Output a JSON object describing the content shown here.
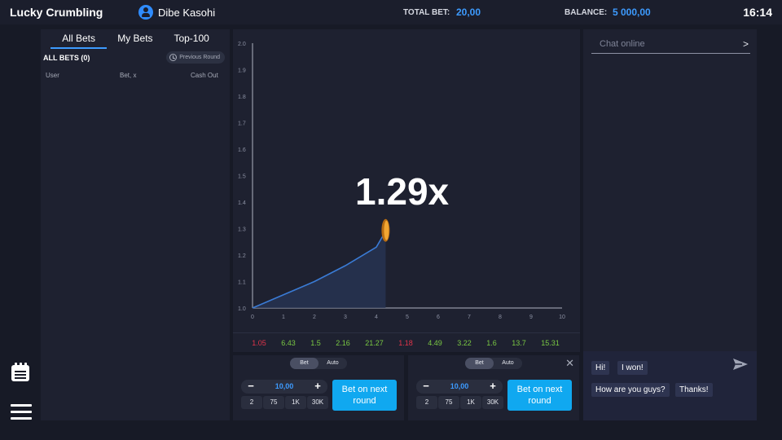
{
  "header": {
    "brand": "Lucky Crumbling",
    "username": "Dibe Kasohi",
    "total_bet_label": "TOTAL BET:",
    "total_bet_value": "20,00",
    "balance_label": "BALANCE:",
    "balance_value": "5 000,00",
    "time": "16:14"
  },
  "bets_panel": {
    "tabs": [
      "All Bets",
      "My Bets",
      "Top-100"
    ],
    "active_tab": "All Bets",
    "all_bets_label": "ALL BETS (0)",
    "previous_round_label": "Previous Round",
    "columns": [
      "User",
      "Bet, x",
      "Cash Out"
    ]
  },
  "game": {
    "multiplier": "1.29x",
    "history": [
      {
        "value": "1.05",
        "color": "#e0344a"
      },
      {
        "value": "6.43",
        "color": "#7ac943"
      },
      {
        "value": "1.5",
        "color": "#7ac943"
      },
      {
        "value": "2.16",
        "color": "#7ac943"
      },
      {
        "value": "21.27",
        "color": "#7ac943"
      },
      {
        "value": "1.18",
        "color": "#e0344a"
      },
      {
        "value": "4.49",
        "color": "#7ac943"
      },
      {
        "value": "3.22",
        "color": "#7ac943"
      },
      {
        "value": "1.6",
        "color": "#7ac943"
      },
      {
        "value": "13.7",
        "color": "#7ac943"
      },
      {
        "value": "15.31",
        "color": "#7ac943"
      }
    ]
  },
  "chart_data": {
    "type": "line",
    "x_ticks": [
      "0",
      "1",
      "2",
      "3",
      "4",
      "5",
      "6",
      "7",
      "8",
      "9",
      "10"
    ],
    "y_ticks": [
      "1.0",
      "1.1",
      "1.2",
      "1.3",
      "1.4",
      "1.5",
      "1.6",
      "1.7",
      "1.8",
      "1.9",
      "2.0"
    ],
    "xlim": [
      0,
      10
    ],
    "ylim": [
      1.0,
      2.0
    ],
    "series": [
      {
        "x": [
          0,
          1,
          2,
          3,
          4,
          4.3
        ],
        "y": [
          1.0,
          1.05,
          1.1,
          1.16,
          1.23,
          1.29
        ],
        "color": "#3a7bd5"
      }
    ]
  },
  "bet_panels": [
    {
      "mode_tabs": [
        "Bet",
        "Auto"
      ],
      "active_mode": "Bet",
      "amount": "10,00",
      "minus": "−",
      "plus": "+",
      "quick": [
        "2",
        "75",
        "1K",
        "30K"
      ],
      "button_label": "Bet on next round"
    },
    {
      "mode_tabs": [
        "Bet",
        "Auto"
      ],
      "active_mode": "Bet",
      "amount": "10,00",
      "minus": "−",
      "plus": "+",
      "quick": [
        "2",
        "75",
        "1K",
        "30K"
      ],
      "button_label": "Bet on next round",
      "close": "✕"
    }
  ],
  "chat": {
    "placeholder": "Chat online",
    "arrow": ">",
    "quick_messages": [
      "Hi!",
      "I won!",
      "How are you guys?",
      "Thanks!"
    ]
  },
  "icons": {
    "user": "user-circle-icon",
    "calendar": "calendar-icon",
    "menu": "hamburger-menu-icon",
    "history": "clock-icon",
    "send": "send-icon",
    "coin": "coin-icon"
  }
}
